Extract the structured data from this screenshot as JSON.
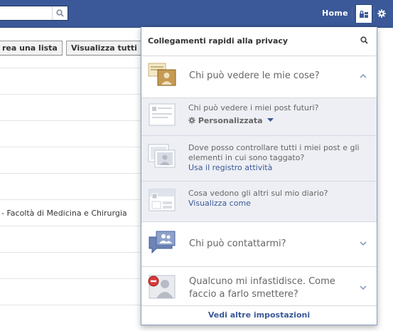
{
  "topbar": {
    "home_label": "Home",
    "icons": {
      "search": "search-icon",
      "privacy": "lock-icon",
      "settings": "gear-icon"
    }
  },
  "background_page": {
    "buttons": [
      "rea una lista",
      "Visualizza tutti"
    ],
    "list_rows": [
      "",
      "",
      "",
      "",
      "",
      "- Facoltà di Medicina e Chirurgia",
      "",
      "",
      "",
      ""
    ]
  },
  "flyout": {
    "title": "Collegamenti rapidi alla privacy",
    "sections": [
      {
        "title": "Chi può vedere le mie cose?",
        "expanded": true,
        "items": [
          {
            "text": "Chi può vedere i miei post futuri?",
            "control_label": "Personalizzata"
          },
          {
            "text": "Dove posso controllare tutti i miei post e gli elementi in cui sono taggato?",
            "link": "Usa il registro attività"
          },
          {
            "text": "Cosa vedono gli altri sul mio diario?",
            "link": "Visualizza come"
          }
        ]
      },
      {
        "title": "Chi può contattarmi?",
        "expanded": false
      },
      {
        "title": "Qualcuno mi infastidisce. Come faccio a farlo smettere?",
        "expanded": false
      }
    ],
    "footer_link": "Vedi altre impostazioni"
  },
  "colors": {
    "brand": "#3b5998",
    "subpanel": "#edeff4",
    "link": "#3b5998"
  }
}
